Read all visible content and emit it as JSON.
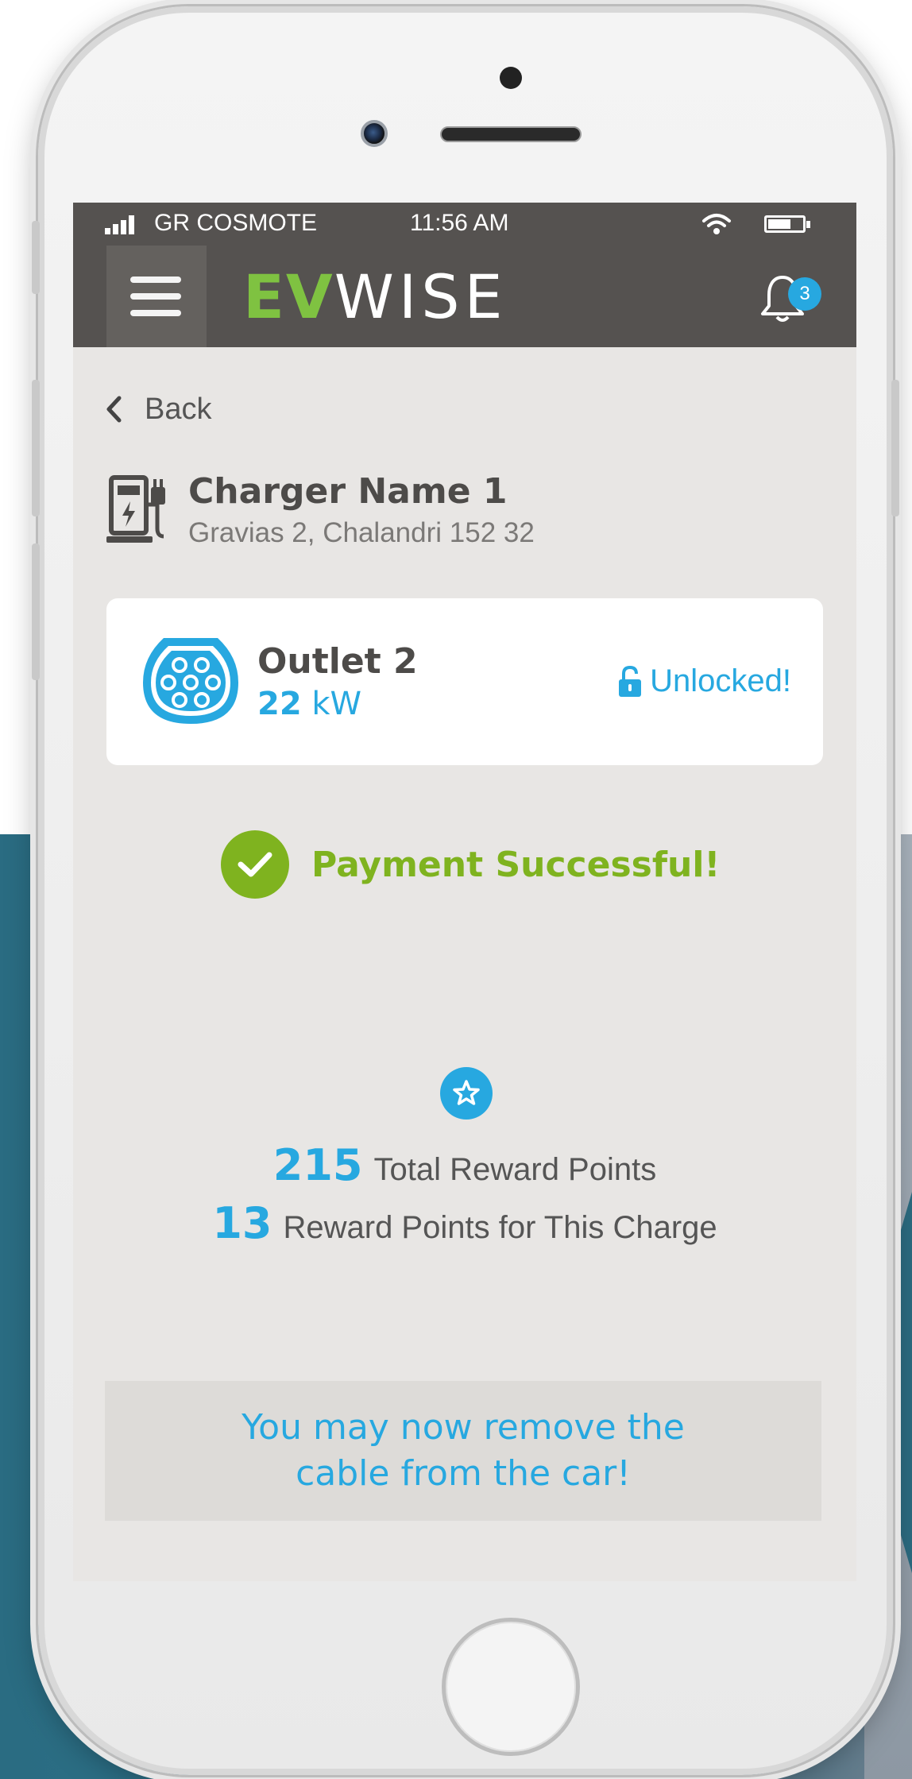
{
  "status_bar": {
    "carrier": "GR COSMOTE",
    "time": "11:56 AM"
  },
  "app_bar": {
    "logo_ev": "EV",
    "logo_wise": "WISE",
    "notification_count": "3"
  },
  "nav": {
    "back_label": "Back"
  },
  "charger": {
    "name": "Charger Name 1",
    "address": "Gravias 2, Chalandri 152 32"
  },
  "outlet": {
    "name": "Outlet 2",
    "power_value": "22",
    "power_unit": "kW",
    "status": "Unlocked!"
  },
  "payment": {
    "message": "Payment Successful!"
  },
  "rewards": {
    "total_points": "215",
    "total_label": "Total Reward Points",
    "charge_points": "13",
    "charge_label": "Reward Points for This Charge"
  },
  "notice": {
    "line1": "You may now remove the",
    "line2": "cable from the car!"
  },
  "colors": {
    "accent_blue": "#27a8e0",
    "success_green": "#7fb31f",
    "brand_green": "#7fc241",
    "header_bg": "#555250"
  }
}
